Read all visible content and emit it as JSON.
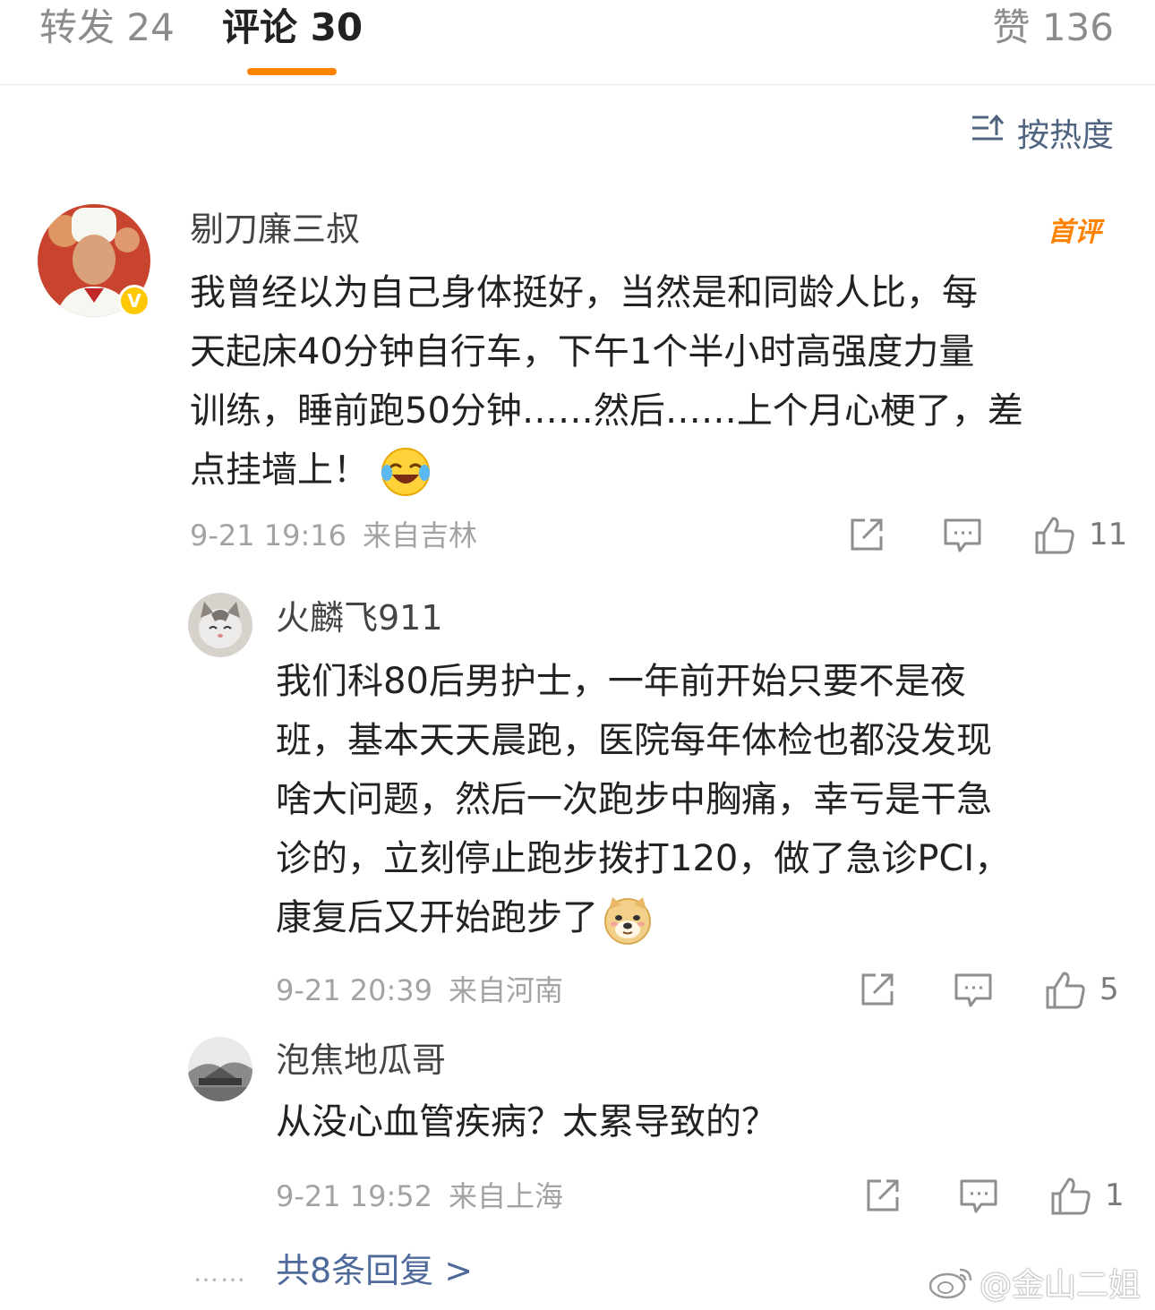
{
  "tabs": {
    "repost": "转发 24",
    "comments": "评论 30",
    "likes": "赞 136",
    "active_color": "#ff8200"
  },
  "sort": {
    "label": "按热度",
    "icon": "sort-icon"
  },
  "main_comment": {
    "username": "剔刀廉三叔",
    "badge": "首评",
    "verified": true,
    "lines": [
      "我曾经以为自己身体挺好，当然是和同龄人比，每",
      "天起床40分钟自行车，下午1个半小时高强度力量",
      "训练，睡前跑50分钟……然后……上个月心梗了，差",
      "点挂墙上！"
    ],
    "emoji": "laughing-crying-emoji",
    "date": "9-21 19:16",
    "location": "来自吉林",
    "likes": "11"
  },
  "replies": [
    {
      "username": "火麟飞911",
      "lines": [
        "我们科80后男护士，一年前开始只要不是夜",
        "班，基本天天晨跑，医院每年体检也都没发现",
        "啥大问题，然后一次跑步中胸痛，幸亏是干急",
        "诊的，立刻停止跑步拨打120，做了急诊PCI，",
        "康复后又开始跑步了"
      ],
      "emoji": "doge-emoji",
      "date": "9-21 20:39",
      "location": "来自河南",
      "likes": "5"
    },
    {
      "username": "泡焦地瓜哥",
      "lines": [
        "从没心血管疾病？太累导致的？"
      ],
      "date": "9-21 19:52",
      "location": "来自上海",
      "likes": "1"
    }
  ],
  "more_dots": "……",
  "more_replies": "共8条回复 >",
  "watermark": "@金山二姐",
  "colors": {
    "link": "#4f6a9a",
    "meta": "#a3a3a3",
    "accent": "#ff8200"
  }
}
